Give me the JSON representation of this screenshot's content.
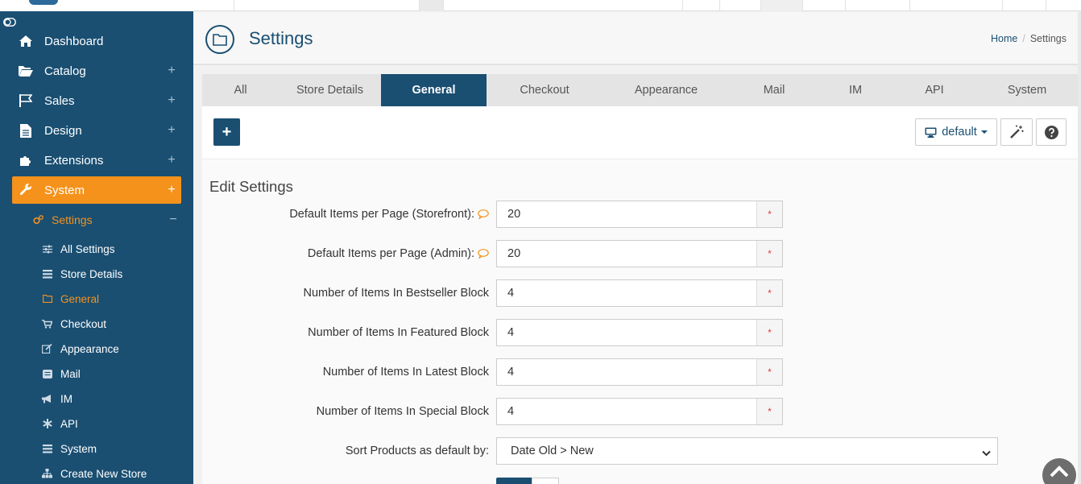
{
  "sidebar": {
    "items": [
      {
        "label": "Dashboard",
        "icon": "home-icon",
        "expandable": false
      },
      {
        "label": "Catalog",
        "icon": "folder-open-icon",
        "expandable": true
      },
      {
        "label": "Sales",
        "icon": "flag-icon",
        "expandable": true
      },
      {
        "label": "Design",
        "icon": "file-icon",
        "expandable": true
      },
      {
        "label": "Extensions",
        "icon": "puzzle-icon",
        "expandable": true
      },
      {
        "label": "System",
        "icon": "wrench-icon",
        "expandable": true,
        "active": true
      }
    ],
    "submenu": {
      "label": "Settings",
      "icon": "cogs-icon"
    },
    "subitems": [
      {
        "label": "All Settings",
        "icon": "sliders-icon"
      },
      {
        "label": "Store Details",
        "icon": "list-icon"
      },
      {
        "label": "General",
        "icon": "folder-icon",
        "active": true
      },
      {
        "label": "Checkout",
        "icon": "cart-icon"
      },
      {
        "label": "Appearance",
        "icon": "edit-icon"
      },
      {
        "label": "Mail",
        "icon": "envelope-icon"
      },
      {
        "label": "IM",
        "icon": "bullhorn-icon"
      },
      {
        "label": "API",
        "icon": "asterisk-icon"
      },
      {
        "label": "System",
        "icon": "list-icon"
      },
      {
        "label": "Create New Store",
        "icon": "sitemap-icon"
      }
    ],
    "plus_symbol": "+",
    "minus_symbol": "−"
  },
  "header": {
    "title": "Settings",
    "breadcrumb": {
      "home": "Home",
      "separator": "/",
      "current": "Settings"
    }
  },
  "tabs": [
    {
      "label": "All"
    },
    {
      "label": "Store Details"
    },
    {
      "label": "General",
      "active": true
    },
    {
      "label": "Checkout"
    },
    {
      "label": "Appearance"
    },
    {
      "label": "Mail"
    },
    {
      "label": "IM"
    },
    {
      "label": "API"
    },
    {
      "label": "System"
    }
  ],
  "toolbar": {
    "add_label": "+",
    "template_label": "default"
  },
  "form": {
    "section_title": "Edit Settings",
    "required_mark": "*",
    "fields": [
      {
        "label": "Default Items per Page (Storefront):",
        "value": "20",
        "hint": true
      },
      {
        "label": "Default Items per Page (Admin):",
        "value": "20",
        "hint": true
      },
      {
        "label": "Number of Items In Bestseller Block",
        "value": "4",
        "hint": false
      },
      {
        "label": "Number of Items In Featured Block",
        "value": "4",
        "hint": false
      },
      {
        "label": "Number of Items In Latest Block",
        "value": "4",
        "hint": false
      },
      {
        "label": "Number of Items In Special Block",
        "value": "4",
        "hint": false
      }
    ],
    "sort": {
      "label": "Sort Products as default by:",
      "value": "Date Old > New"
    }
  },
  "colors": {
    "primary": "#1a4f72",
    "accent": "#f5921b",
    "required": "#e23b3b"
  }
}
